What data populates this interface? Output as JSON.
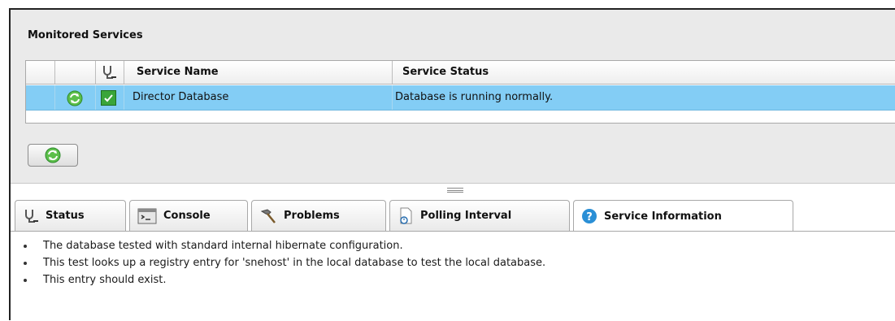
{
  "panel": {
    "title": "Monitored Services"
  },
  "grid": {
    "headers": {
      "service_name": "Service Name",
      "service_status": "Service Status"
    },
    "rows": [
      {
        "name": "Director Database",
        "status": "Database is running normally.",
        "checked": true
      }
    ]
  },
  "tabs": [
    {
      "label": "Status",
      "icon": "stethoscope-icon"
    },
    {
      "label": "Console",
      "icon": "console-icon"
    },
    {
      "label": "Problems",
      "icon": "hammer-icon"
    },
    {
      "label": "Polling Interval",
      "icon": "polling-document-icon"
    },
    {
      "label": "Service Information",
      "icon": "help-icon",
      "active": true
    }
  ],
  "info_lines": [
    "The database tested with standard internal hibernate configuration.",
    "This test looks up a registry entry for 'snehost' in the local database to test the local database.",
    "This entry should exist."
  ],
  "colors": {
    "selected_row": "#83cdf5",
    "help_icon": "#2a8fd6",
    "refresh_green": "#3aa53a"
  }
}
